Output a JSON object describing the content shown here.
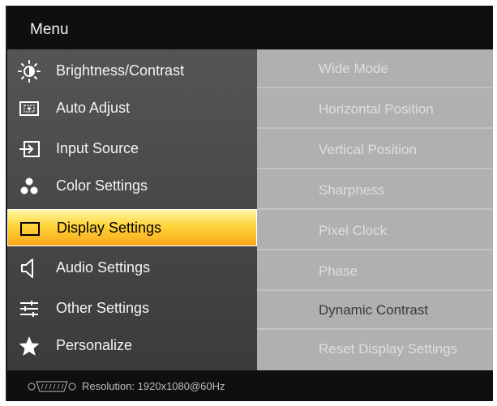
{
  "header": {
    "title": "Menu"
  },
  "menu": {
    "items": [
      {
        "label": "Brightness/Contrast",
        "icon": "brightness-icon"
      },
      {
        "label": "Auto Adjust",
        "icon": "auto-adjust-icon"
      },
      {
        "label": "Input Source",
        "icon": "input-source-icon"
      },
      {
        "label": "Color Settings",
        "icon": "color-settings-icon"
      },
      {
        "label": "Display Settings",
        "icon": "display-settings-icon",
        "selected": true
      },
      {
        "label": "Audio Settings",
        "icon": "speaker-icon"
      },
      {
        "label": "Other Settings",
        "icon": "sliders-icon"
      },
      {
        "label": "Personalize",
        "icon": "star-icon"
      }
    ]
  },
  "submenu": {
    "items": [
      {
        "label": "Wide Mode",
        "enabled": true
      },
      {
        "label": "Horizontal Position",
        "enabled": true
      },
      {
        "label": "Vertical Position",
        "enabled": true
      },
      {
        "label": "Sharpness",
        "enabled": true
      },
      {
        "label": "Pixel Clock",
        "enabled": true
      },
      {
        "label": "Phase",
        "enabled": true
      },
      {
        "label": "Dynamic Contrast",
        "enabled": false
      },
      {
        "label": "Reset Display Settings",
        "enabled": true
      }
    ]
  },
  "footer": {
    "resolution": "Resolution: 1920x1080@60Hz",
    "connector_icon": "vga-icon"
  },
  "colors": {
    "header_bg": "#0f0f0f",
    "left_panel_bg": "#474747",
    "right_panel_bg": "#b0b0b0",
    "selected_gradient_top": "#fff7a6",
    "selected_gradient_bottom": "#f9a81c"
  }
}
